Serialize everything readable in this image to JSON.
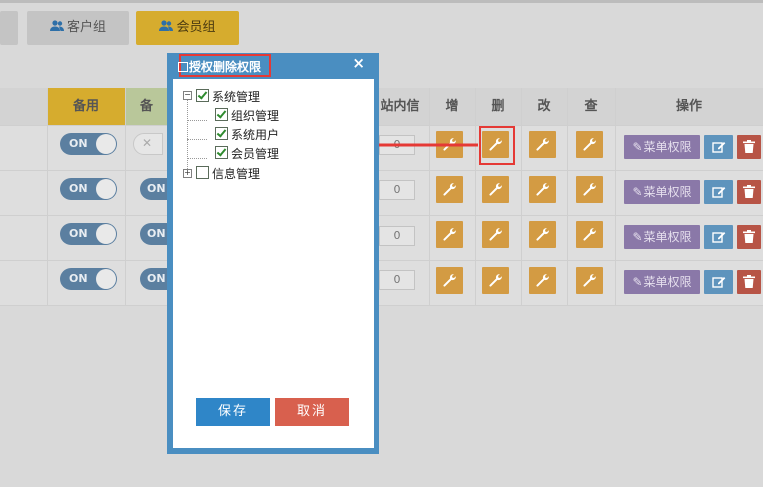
{
  "groups": [
    {
      "label": "客户组"
    },
    {
      "label": "会员组"
    }
  ],
  "table": {
    "headers": {
      "backup1": "备用",
      "backup2": "备",
      "msg": "站内信",
      "add": "增",
      "del": "删",
      "edit": "改",
      "view": "查",
      "ops": "操作"
    },
    "toggle_on": "ON",
    "msg_value": "0",
    "menu_perm": "菜单权限"
  },
  "dialog": {
    "title": "授权删除权限",
    "close": "×",
    "tree": {
      "root": "系统管理",
      "children": [
        "组织管理",
        "系统用户",
        "会员管理"
      ],
      "other": "信息管理"
    },
    "save": "保存",
    "cancel": "取消"
  },
  "colors": {
    "dialog_header": "#4a8ec1",
    "save": "#2f86c8",
    "cancel": "#d8604e",
    "wrench_btn": "#d39b43",
    "menu_btn": "#8a78a8",
    "highlight": "#e53935"
  }
}
